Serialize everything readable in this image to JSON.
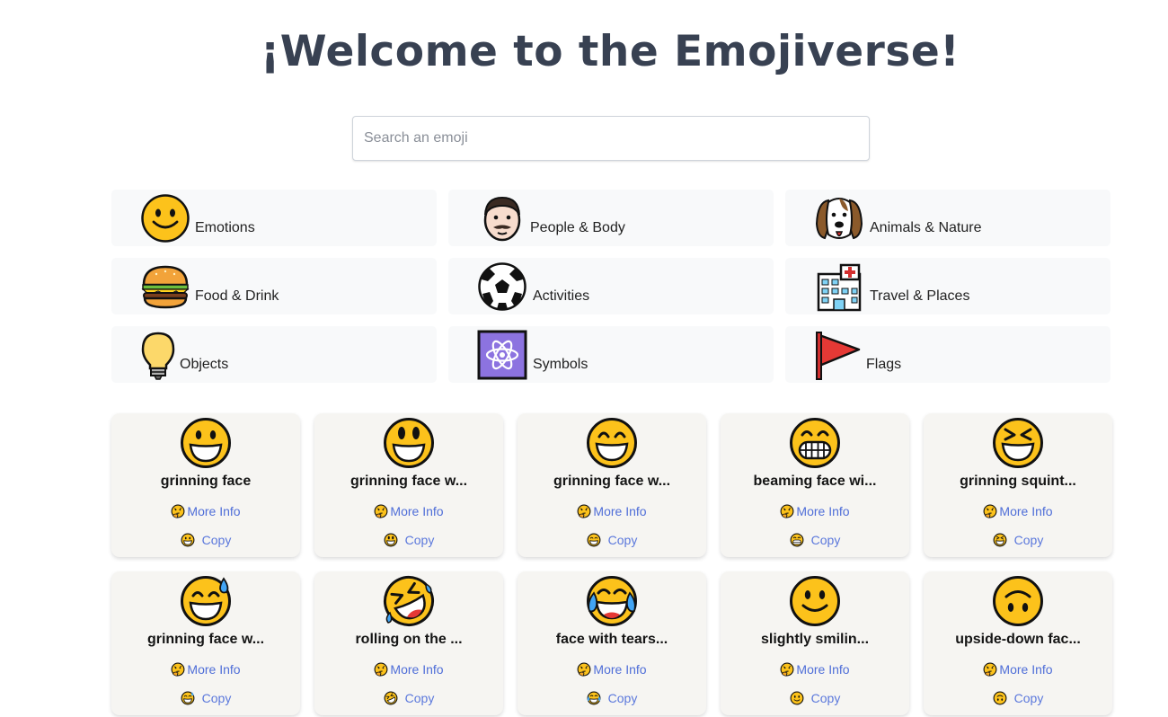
{
  "header": {
    "title": "¡Welcome to the Emojiverse!"
  },
  "search": {
    "placeholder": "Search an emoji",
    "value": ""
  },
  "categories": [
    {
      "label": "Emotions",
      "icon": "smiling-face-icon"
    },
    {
      "label": "People & Body",
      "icon": "man-face-icon"
    },
    {
      "label": "Animals & Nature",
      "icon": "dog-face-icon"
    },
    {
      "label": "Food & Drink",
      "icon": "hamburger-icon"
    },
    {
      "label": "Activities",
      "icon": "soccer-ball-icon"
    },
    {
      "label": "Travel & Places",
      "icon": "hospital-building-icon"
    },
    {
      "label": "Objects",
      "icon": "light-bulb-icon"
    },
    {
      "label": "Symbols",
      "icon": "atom-symbol-icon"
    },
    {
      "label": "Flags",
      "icon": "triangular-flag-icon"
    }
  ],
  "emoji_cards": [
    {
      "name": "grinning face",
      "icon": "grinning-face-icon"
    },
    {
      "name": "grinning face w...",
      "icon": "grinning-face-big-eyes-icon"
    },
    {
      "name": "grinning face w...",
      "icon": "grinning-face-smiling-eyes-icon"
    },
    {
      "name": "beaming face wi...",
      "icon": "beaming-face-icon"
    },
    {
      "name": "grinning squint...",
      "icon": "grinning-squinting-face-icon"
    },
    {
      "name": "grinning face w...",
      "icon": "grinning-face-sweat-icon"
    },
    {
      "name": "rolling on the ...",
      "icon": "rolling-on-floor-laughing-icon"
    },
    {
      "name": "face with tears...",
      "icon": "face-tears-of-joy-icon"
    },
    {
      "name": "slightly smilin...",
      "icon": "slightly-smiling-face-icon"
    },
    {
      "name": "upside-down fac...",
      "icon": "upside-down-face-icon"
    }
  ],
  "card_actions": {
    "more_info_label": "More Info",
    "more_info_icon": "thinking-face-icon",
    "copy_label": "Copy"
  },
  "colors": {
    "title": "#384152",
    "link": "#4f6ed8",
    "card_bg": "#f6f5f2",
    "category_bg": "#f8f9fa",
    "emoji_yellow": "#fcc21b"
  }
}
